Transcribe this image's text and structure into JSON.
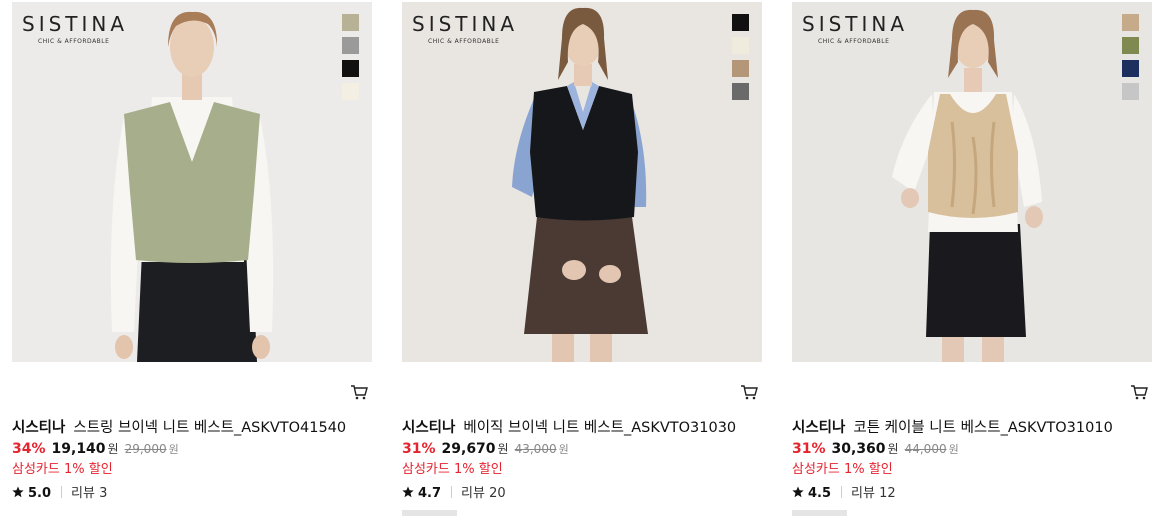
{
  "products": [
    {
      "logo": {
        "word": "SISTINA",
        "tagline": "CHIC & AFFORDABLE"
      },
      "swatches": [
        "#b7b295",
        "#9a9a9a",
        "#111111",
        "#f3f0e3"
      ],
      "bg": "#ecebe9",
      "garment": "#a7ae8b",
      "brand": "시스티나",
      "name": "스트링 브이넥 니트 베스트_ASKVTO41540",
      "discount": "34%",
      "price": "19,140",
      "currency": "원",
      "original_price": "29,000",
      "card_offer": "삼성카드 1% 할인",
      "rating": "5.0",
      "reviews": "리뷰 3"
    },
    {
      "logo": {
        "word": "SISTINA",
        "tagline": "CHIC & AFFORDABLE"
      },
      "swatches": [
        "#111111",
        "#efebdd",
        "#b39778",
        "#6a6a6a"
      ],
      "bg": "#e9e5e1",
      "garment": "#15171b",
      "brand": "시스티나",
      "name": "베이직 브이넥 니트 베스트_ASKVTO31030",
      "discount": "31%",
      "price": "29,670",
      "currency": "원",
      "original_price": "43,000",
      "card_offer": "삼성카드 1% 할인",
      "rating": "4.7",
      "reviews": "리뷰 20"
    },
    {
      "logo": {
        "word": "SISTINA",
        "tagline": "CHIC & AFFORDABLE"
      },
      "swatches": [
        "#c6ab8a",
        "#7e8a4f",
        "#1c2f5e",
        "#c6c6c6"
      ],
      "bg": "#e7e6e3",
      "garment": "#d8c09c",
      "brand": "시스티나",
      "name": "코튼 케이블 니트 베스트_ASKVTO31010",
      "discount": "31%",
      "price": "30,360",
      "currency": "원",
      "original_price": "44,000",
      "card_offer": "삼성카드 1% 할인",
      "rating": "4.5",
      "reviews": "리뷰 12"
    }
  ]
}
